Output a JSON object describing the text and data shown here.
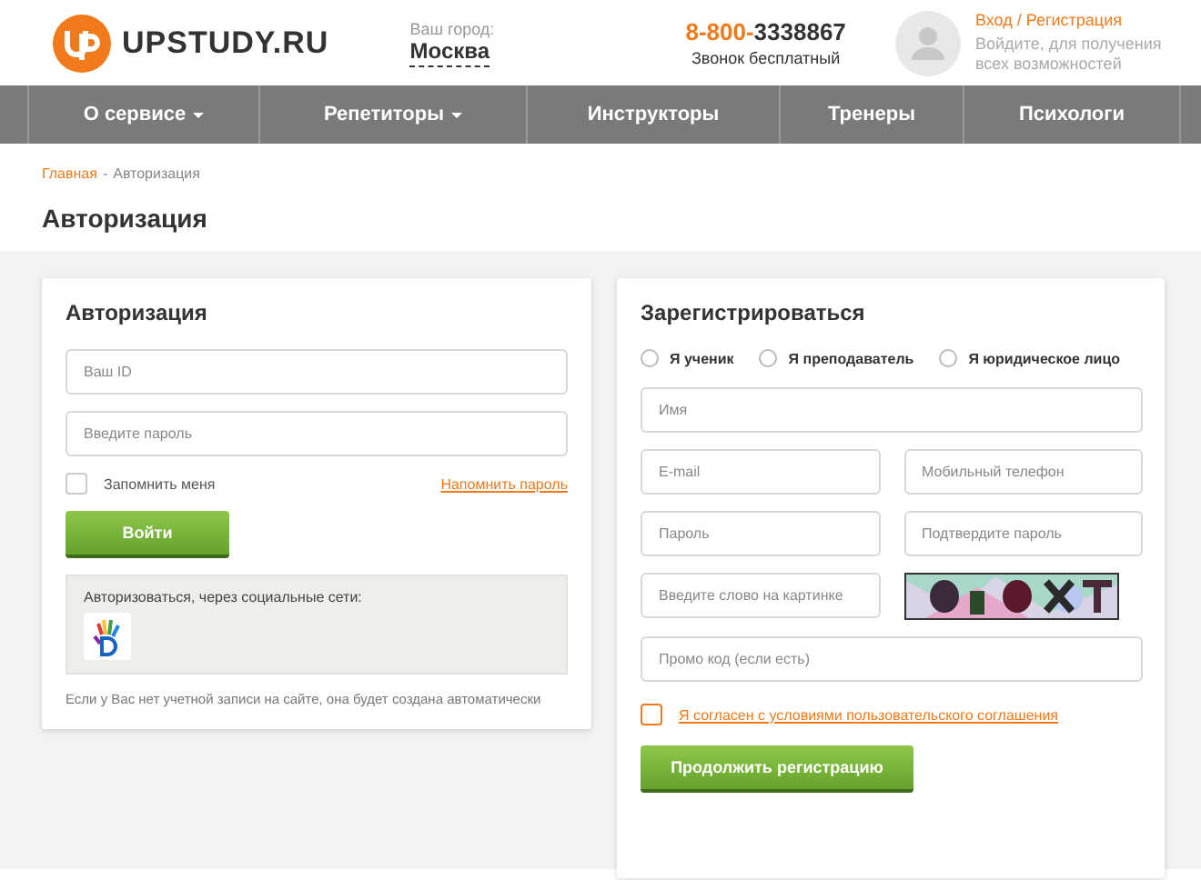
{
  "header": {
    "logo_text": "UPSTUDY.RU",
    "city_label": "Ваш город:",
    "city": "Москва",
    "phone_prefix": "8-800-",
    "phone_number": "3338867",
    "phone_note": "Звонок бесплатный",
    "login_link": "Вход / Регистрация",
    "login_note": "Войдите, для получения всех возможностей"
  },
  "nav": [
    {
      "label": "О сервисе",
      "dropdown": true
    },
    {
      "label": "Репетиторы",
      "dropdown": true
    },
    {
      "label": "Инструкторы",
      "dropdown": false
    },
    {
      "label": "Тренеры",
      "dropdown": false
    },
    {
      "label": "Психологи",
      "dropdown": false
    }
  ],
  "breadcrumb": {
    "home": "Главная",
    "separator": "-",
    "current": "Авторизация"
  },
  "page_title": "Авторизация",
  "login": {
    "title": "Авторизация",
    "id_placeholder": "Ваш ID",
    "password_placeholder": "Введите пароль",
    "remember": {
      "label": "Запомнить меня",
      "checked": false
    },
    "forgot_link": "Напомнить пароль",
    "submit": "Войти",
    "social_label": "Авторизоваться, через социальные сети:",
    "note": "Если у Вас нет учетной записи на сайте, она будет создана автоматически"
  },
  "register": {
    "title": "Зарегистрироваться",
    "roles": [
      {
        "label": "Я ученик",
        "selected": false
      },
      {
        "label": "Я преподаватель",
        "selected": false
      },
      {
        "label": "Я юридическое лицо",
        "selected": false
      }
    ],
    "name_placeholder": "Имя",
    "email_placeholder": "E-mail",
    "phone_placeholder": "Мобильный телефон",
    "password_placeholder": "Пароль",
    "confirm_placeholder": "Подтвердите пароль",
    "captcha_placeholder": "Введите слово на картинке",
    "promo_placeholder": "Промо код (если есть)",
    "agree": {
      "label": "Я согласен с условиями пользовательского соглашения",
      "checked": false
    },
    "submit": "Продолжить регистрацию"
  }
}
